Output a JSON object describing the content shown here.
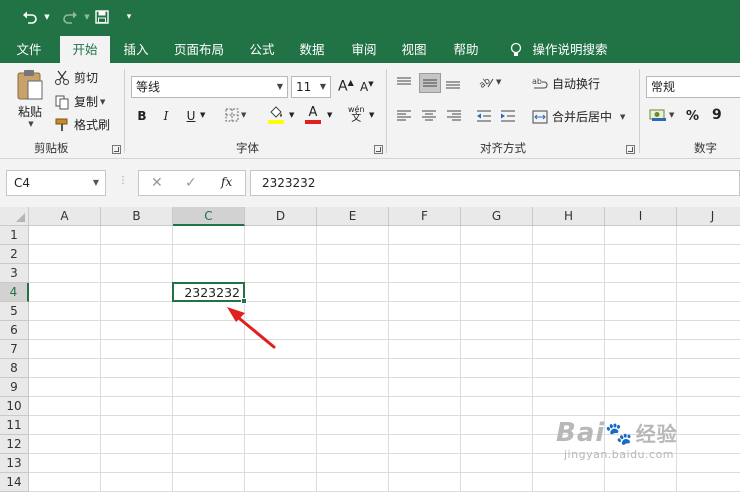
{
  "menu": {
    "tabs": [
      {
        "label": "文件"
      },
      {
        "label": "开始"
      },
      {
        "label": "插入"
      },
      {
        "label": "页面布局"
      },
      {
        "label": "公式"
      },
      {
        "label": "数据"
      },
      {
        "label": "审阅"
      },
      {
        "label": "视图"
      },
      {
        "label": "帮助"
      },
      {
        "label": "操作说明搜索"
      }
    ],
    "active_tab": "开始"
  },
  "ribbon": {
    "clipboard": {
      "paste_label": "粘贴",
      "cut_label": "剪切",
      "copy_label": "复制",
      "format_painter_label": "格式刷",
      "group_label": "剪贴板"
    },
    "font": {
      "font_name": "等线",
      "font_size": "11",
      "bold": "B",
      "italic": "I",
      "underline": "U",
      "phonetic_top": "wén",
      "phonetic_bottom": "文",
      "group_label": "字体"
    },
    "alignment": {
      "wrap_text_label": "自动换行",
      "merge_center_label": "合并后居中",
      "group_label": "对齐方式"
    },
    "number": {
      "format": "常规",
      "percent": "%",
      "comma": "9",
      "group_label": "数字"
    }
  },
  "formula_bar": {
    "name_box": "C4",
    "fx_label": "fx",
    "value": "2323232"
  },
  "sheet": {
    "columns": [
      "A",
      "B",
      "C",
      "D",
      "E",
      "F",
      "G",
      "H",
      "I",
      "J"
    ],
    "rows": [
      "1",
      "2",
      "3",
      "4",
      "5",
      "6",
      "7",
      "8",
      "9",
      "10",
      "11",
      "12",
      "13",
      "14"
    ],
    "active_cell": "C4",
    "active_cell_value": "2323232"
  },
  "watermark": {
    "brand": "Bai",
    "brand2": "经验",
    "url": "jingyan.baidu.com"
  },
  "colors": {
    "excel_green": "#217346",
    "annotation_red": "#e0201c"
  }
}
